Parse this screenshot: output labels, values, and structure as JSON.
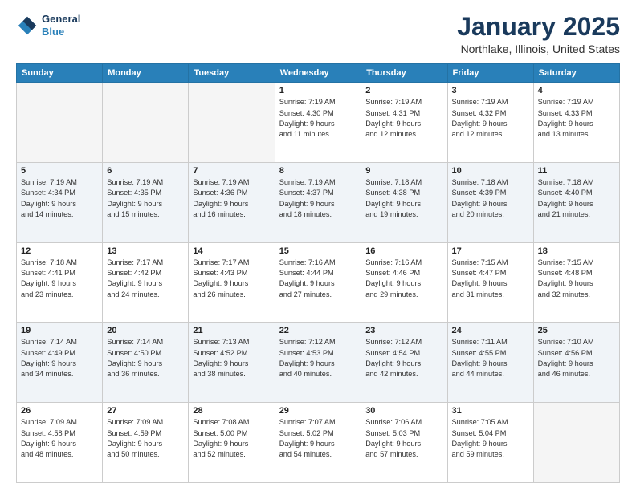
{
  "logo": {
    "line1": "General",
    "line2": "Blue"
  },
  "header": {
    "title": "January 2025",
    "subtitle": "Northlake, Illinois, United States"
  },
  "weekdays": [
    "Sunday",
    "Monday",
    "Tuesday",
    "Wednesday",
    "Thursday",
    "Friday",
    "Saturday"
  ],
  "weeks": [
    [
      {
        "day": "",
        "info": ""
      },
      {
        "day": "",
        "info": ""
      },
      {
        "day": "",
        "info": ""
      },
      {
        "day": "1",
        "info": "Sunrise: 7:19 AM\nSunset: 4:30 PM\nDaylight: 9 hours\nand 11 minutes."
      },
      {
        "day": "2",
        "info": "Sunrise: 7:19 AM\nSunset: 4:31 PM\nDaylight: 9 hours\nand 12 minutes."
      },
      {
        "day": "3",
        "info": "Sunrise: 7:19 AM\nSunset: 4:32 PM\nDaylight: 9 hours\nand 12 minutes."
      },
      {
        "day": "4",
        "info": "Sunrise: 7:19 AM\nSunset: 4:33 PM\nDaylight: 9 hours\nand 13 minutes."
      }
    ],
    [
      {
        "day": "5",
        "info": "Sunrise: 7:19 AM\nSunset: 4:34 PM\nDaylight: 9 hours\nand 14 minutes."
      },
      {
        "day": "6",
        "info": "Sunrise: 7:19 AM\nSunset: 4:35 PM\nDaylight: 9 hours\nand 15 minutes."
      },
      {
        "day": "7",
        "info": "Sunrise: 7:19 AM\nSunset: 4:36 PM\nDaylight: 9 hours\nand 16 minutes."
      },
      {
        "day": "8",
        "info": "Sunrise: 7:19 AM\nSunset: 4:37 PM\nDaylight: 9 hours\nand 18 minutes."
      },
      {
        "day": "9",
        "info": "Sunrise: 7:18 AM\nSunset: 4:38 PM\nDaylight: 9 hours\nand 19 minutes."
      },
      {
        "day": "10",
        "info": "Sunrise: 7:18 AM\nSunset: 4:39 PM\nDaylight: 9 hours\nand 20 minutes."
      },
      {
        "day": "11",
        "info": "Sunrise: 7:18 AM\nSunset: 4:40 PM\nDaylight: 9 hours\nand 21 minutes."
      }
    ],
    [
      {
        "day": "12",
        "info": "Sunrise: 7:18 AM\nSunset: 4:41 PM\nDaylight: 9 hours\nand 23 minutes."
      },
      {
        "day": "13",
        "info": "Sunrise: 7:17 AM\nSunset: 4:42 PM\nDaylight: 9 hours\nand 24 minutes."
      },
      {
        "day": "14",
        "info": "Sunrise: 7:17 AM\nSunset: 4:43 PM\nDaylight: 9 hours\nand 26 minutes."
      },
      {
        "day": "15",
        "info": "Sunrise: 7:16 AM\nSunset: 4:44 PM\nDaylight: 9 hours\nand 27 minutes."
      },
      {
        "day": "16",
        "info": "Sunrise: 7:16 AM\nSunset: 4:46 PM\nDaylight: 9 hours\nand 29 minutes."
      },
      {
        "day": "17",
        "info": "Sunrise: 7:15 AM\nSunset: 4:47 PM\nDaylight: 9 hours\nand 31 minutes."
      },
      {
        "day": "18",
        "info": "Sunrise: 7:15 AM\nSunset: 4:48 PM\nDaylight: 9 hours\nand 32 minutes."
      }
    ],
    [
      {
        "day": "19",
        "info": "Sunrise: 7:14 AM\nSunset: 4:49 PM\nDaylight: 9 hours\nand 34 minutes."
      },
      {
        "day": "20",
        "info": "Sunrise: 7:14 AM\nSunset: 4:50 PM\nDaylight: 9 hours\nand 36 minutes."
      },
      {
        "day": "21",
        "info": "Sunrise: 7:13 AM\nSunset: 4:52 PM\nDaylight: 9 hours\nand 38 minutes."
      },
      {
        "day": "22",
        "info": "Sunrise: 7:12 AM\nSunset: 4:53 PM\nDaylight: 9 hours\nand 40 minutes."
      },
      {
        "day": "23",
        "info": "Sunrise: 7:12 AM\nSunset: 4:54 PM\nDaylight: 9 hours\nand 42 minutes."
      },
      {
        "day": "24",
        "info": "Sunrise: 7:11 AM\nSunset: 4:55 PM\nDaylight: 9 hours\nand 44 minutes."
      },
      {
        "day": "25",
        "info": "Sunrise: 7:10 AM\nSunset: 4:56 PM\nDaylight: 9 hours\nand 46 minutes."
      }
    ],
    [
      {
        "day": "26",
        "info": "Sunrise: 7:09 AM\nSunset: 4:58 PM\nDaylight: 9 hours\nand 48 minutes."
      },
      {
        "day": "27",
        "info": "Sunrise: 7:09 AM\nSunset: 4:59 PM\nDaylight: 9 hours\nand 50 minutes."
      },
      {
        "day": "28",
        "info": "Sunrise: 7:08 AM\nSunset: 5:00 PM\nDaylight: 9 hours\nand 52 minutes."
      },
      {
        "day": "29",
        "info": "Sunrise: 7:07 AM\nSunset: 5:02 PM\nDaylight: 9 hours\nand 54 minutes."
      },
      {
        "day": "30",
        "info": "Sunrise: 7:06 AM\nSunset: 5:03 PM\nDaylight: 9 hours\nand 57 minutes."
      },
      {
        "day": "31",
        "info": "Sunrise: 7:05 AM\nSunset: 5:04 PM\nDaylight: 9 hours\nand 59 minutes."
      },
      {
        "day": "",
        "info": ""
      }
    ]
  ]
}
